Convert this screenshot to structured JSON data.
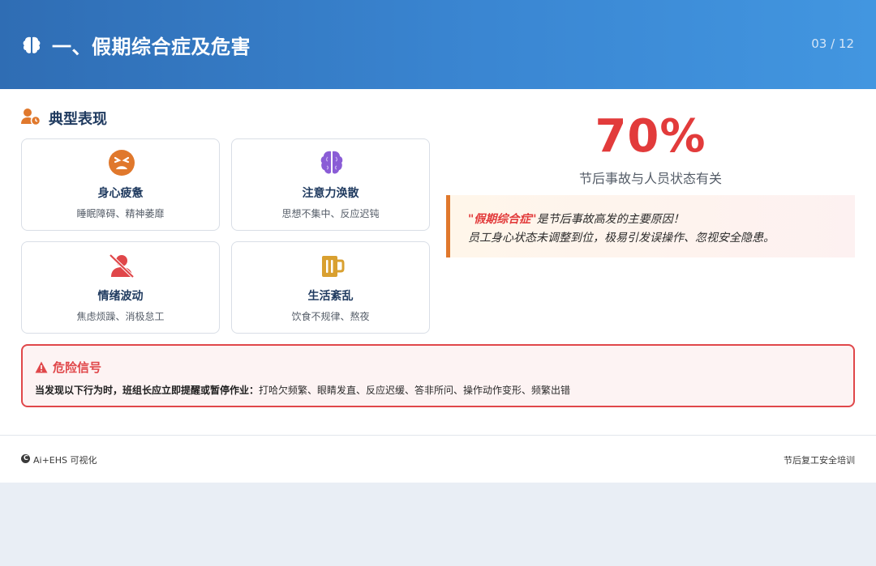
{
  "header": {
    "title": "一、假期综合症及危害",
    "page": "03 / 12",
    "icon": "brain-icon"
  },
  "section": {
    "title": "典型表现",
    "icon": "user-clock-icon"
  },
  "cards": [
    {
      "title": "身心疲惫",
      "desc": "睡眠障碍、精神萎靡",
      "icon": "tired-face-icon",
      "color": "#e0782c"
    },
    {
      "title": "注意力涣散",
      "desc": "思想不集中、反应迟钝",
      "icon": "brain-icon",
      "color": "#8a5cd6"
    },
    {
      "title": "情绪波动",
      "desc": "焦虑烦躁、消极怠工",
      "icon": "user-slash-icon",
      "color": "#e0474a"
    },
    {
      "title": "生活紊乱",
      "desc": "饮食不规律、熬夜",
      "icon": "beer-mug-icon",
      "color": "#d9a030"
    }
  ],
  "stat": {
    "value": "70%",
    "label": "节后事故与人员状态有关"
  },
  "quote": {
    "highlight": "\"假期综合症\"",
    "line1_rest": "是节后事故高发的主要原因！",
    "line2": "员工身心状态未调整到位，极易引发误操作、忽视安全隐患。"
  },
  "danger": {
    "title": "危险信号",
    "lead": "当发现以下行为时，班组长应立即提醒或暂停作业：",
    "text": "打哈欠频繁、眼睛发直、反应迟缓、答非所问、操作动作变形、频繁出错",
    "icon": "warning-triangle-icon"
  },
  "footer": {
    "logo_letter": "C",
    "left": "Ai+EHS 可视化",
    "right": "节后复工安全培训"
  },
  "colors": {
    "header_start": "#2f6db4",
    "header_end": "#4296e0",
    "accent_red": "#e23b3b",
    "accent_orange": "#e0782c",
    "title_navy": "#1f3a5f"
  }
}
